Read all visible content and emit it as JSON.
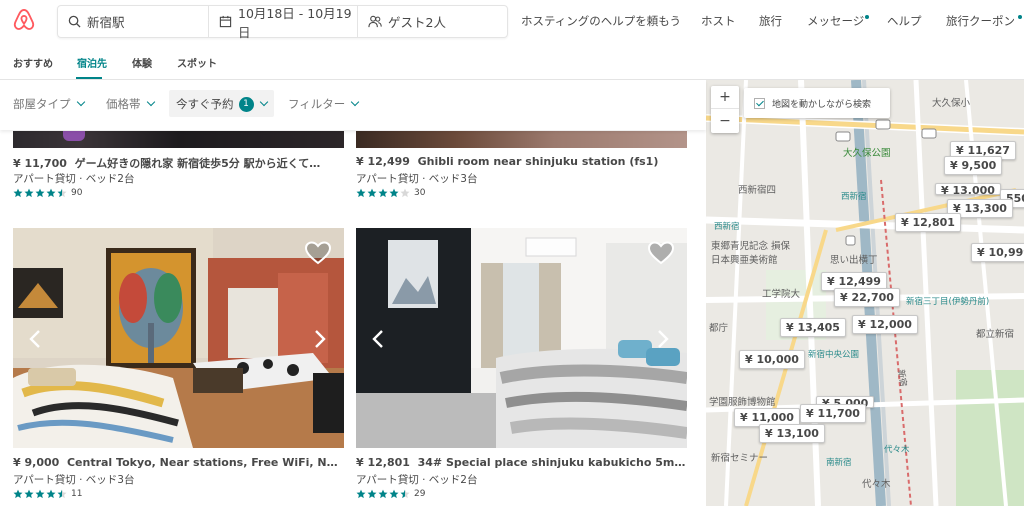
{
  "header": {
    "search_location": "新宿駅",
    "search_dates": "10月18日 - 10月19日",
    "search_guests": "ゲスト2人",
    "nav": [
      "ホスティングのヘルプを頼もう",
      "ホスト",
      "旅行",
      "メッセージ",
      "ヘルプ",
      "旅行クーポン"
    ]
  },
  "tabs": [
    {
      "label": "おすすめ",
      "active": false
    },
    {
      "label": "宿泊先",
      "active": true
    },
    {
      "label": "体験",
      "active": false
    },
    {
      "label": "スポット",
      "active": false
    }
  ],
  "filters": {
    "room_type": "部屋タイプ",
    "price": "価格帯",
    "instant_book": "今すぐ予約",
    "instant_book_count": "1",
    "more": "フィルター"
  },
  "listings": [
    {
      "price": "¥ 11,700",
      "title": "ゲーム好きの隠れ家 新宿徒歩5分 駅から近くて…",
      "sub": "アパート貸切 · ベッド2台",
      "rating": 4.5,
      "reviews": "90"
    },
    {
      "price": "¥ 12,499",
      "title": "Ghibli room near shinjuku station (fs1)",
      "sub": "アパート貸切 · ベッド3台",
      "rating": 4,
      "reviews": "30"
    },
    {
      "price": "¥ 9,000",
      "title": "Central Tokyo, Near stations, Free WiFi, New …",
      "sub": "アパート貸切 · ベッド3台",
      "rating": 4.5,
      "reviews": "11"
    },
    {
      "price": "¥ 12,801",
      "title": "34# Special place shinjuku kabukicho 5min St…",
      "sub": "アパート貸切 · ベッド2台",
      "rating": 4.5,
      "reviews": "29"
    }
  ],
  "map": {
    "checkbox_label": "地図を動かしながら検索",
    "zoom_in": "+",
    "zoom_out": "−",
    "pins": [
      "¥ 11,627",
      "¥ 9,500",
      "¥ 13,000",
      "550",
      "¥ 13,300",
      "¥ 12,801",
      "¥ 10,999",
      "¥ 12,499",
      "¥ 22,700",
      "¥ 13,405",
      "¥ 12,000",
      "¥ 10,000",
      "¥ 5,000",
      "¥ 11,000",
      "¥ 11,700",
      "¥ 13,100"
    ],
    "labels": [
      "大久保公園",
      "大久保小",
      "西新宿四",
      "西新宿",
      "東郷青児記念 損保",
      "日本興亜美術館",
      "工学院大",
      "都庁",
      "新宿中央公園",
      "新宿三丁目(伊勢丹前)",
      "都立新宿",
      "学園服飾博物館",
      "南新宿",
      "代々木",
      "代々木",
      "新宿セミナー",
      "新宿",
      "西新宿",
      "思い出横丁"
    ],
    "route_numbers": [
      "302",
      "302",
      "302",
      "4"
    ]
  },
  "colors": {
    "brand": "#FF5A5F",
    "accent": "#008489",
    "text": "#484848"
  }
}
